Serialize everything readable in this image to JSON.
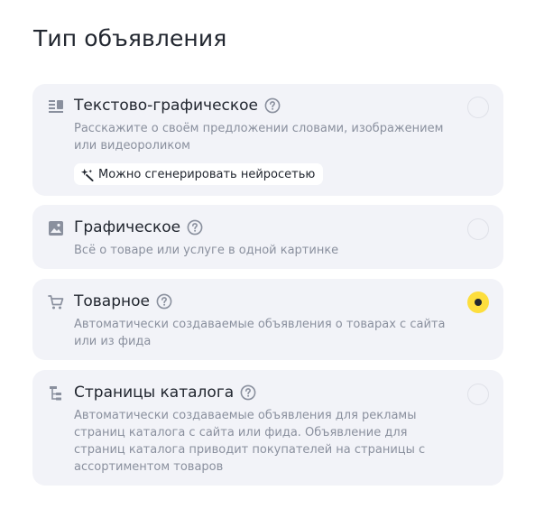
{
  "title": "Тип объявления",
  "options": [
    {
      "id": "text-graphic",
      "icon": "text-lines-icon",
      "title": "Текстово-графическое",
      "description": "Расскажите о своём предложении словами, изображением или видеороликом",
      "badge": "Можно сгенерировать нейросетью",
      "badge_icon": "sparkle-icon",
      "selected": false
    },
    {
      "id": "graphic",
      "icon": "image-icon",
      "title": "Графическое",
      "description": "Всё о товаре или услуге в одной картинке",
      "selected": false
    },
    {
      "id": "product",
      "icon": "cart-icon",
      "title": "Товарное",
      "description": "Автоматически создаваемые объявления о товарах с сайта или из фида",
      "selected": true
    },
    {
      "id": "catalog-pages",
      "icon": "catalog-tree-icon",
      "title": "Страницы каталога",
      "description": "Автоматически создаваемые объявления для рекламы страниц каталога с сайта или фида. Объявление для страниц каталога приводит покупателей на страницы с ассортиментом товаров",
      "selected": false
    }
  ],
  "colors": {
    "card_bg": "#f2f3f8",
    "icon": "#8a909e",
    "radio_selected": "#fdde3d",
    "text": "#21262f",
    "muted": "#8a909e"
  }
}
